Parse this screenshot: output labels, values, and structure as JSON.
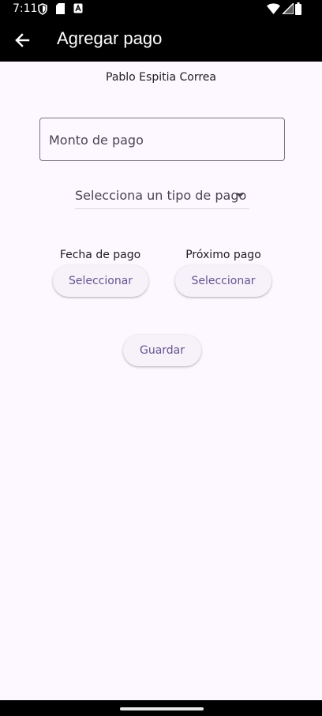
{
  "status_bar": {
    "time": "7:11",
    "left_icons": [
      "shield-icon",
      "sd-card-icon",
      "app-notification-icon"
    ],
    "right_icons": [
      "wifi-icon",
      "signal-icon",
      "battery-icon"
    ]
  },
  "app_bar": {
    "title": "Agregar pago",
    "back_icon": "arrow-back-icon"
  },
  "client": {
    "name": "Pablo Espitia  Correa"
  },
  "form": {
    "amount": {
      "placeholder": "Monto de pago",
      "value": ""
    },
    "payment_type": {
      "label": "Selecciona un tipo de pago",
      "icon": "dropdown-arrow-icon"
    },
    "payment_date": {
      "label": "Fecha de pago",
      "button_label": "Seleccionar"
    },
    "next_payment": {
      "label": "Próximo pago",
      "button_label": "Seleccionar"
    },
    "save_label": "Guardar"
  },
  "colors": {
    "background": "#fdf7ff",
    "bar": "#000000",
    "button_bg": "#f7f2fa",
    "button_text": "#65558f",
    "outline": "#79747e"
  }
}
